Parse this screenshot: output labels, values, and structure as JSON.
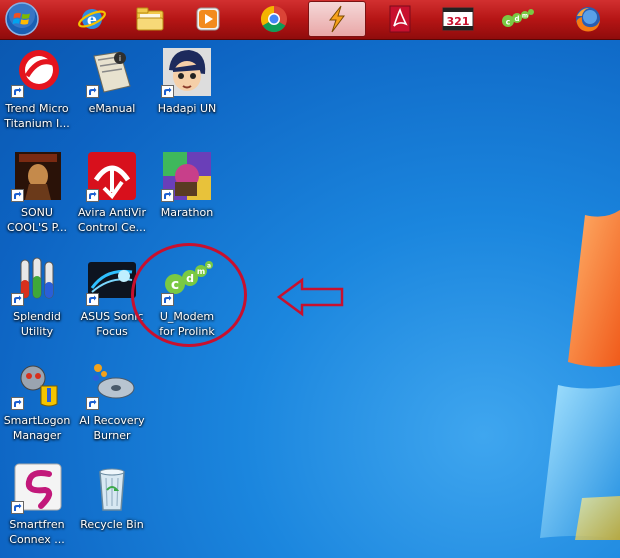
{
  "taskbar": {
    "items": [
      {
        "name": "start-button",
        "icon": "windows-orb-icon"
      },
      {
        "name": "internet-explorer",
        "icon": "internet-explorer-icon"
      },
      {
        "name": "windows-explorer",
        "icon": "folder-icon"
      },
      {
        "name": "media-player",
        "icon": "media-play-icon"
      },
      {
        "name": "chrome",
        "icon": "chrome-icon"
      },
      {
        "name": "winamp",
        "icon": "winamp-icon",
        "active": true
      },
      {
        "name": "acrobat-reader",
        "icon": "pdf-icon"
      },
      {
        "name": "media-player-classic",
        "icon": "media-player-321-icon",
        "text": "321"
      },
      {
        "name": "cdma-modem",
        "icon": "cdma-icon",
        "text": "cdma"
      },
      {
        "name": "firefox",
        "icon": "firefox-icon"
      }
    ]
  },
  "desktop": {
    "icons": [
      {
        "label1": "Trend Micro",
        "label2": "Titanium I..."
      },
      {
        "label1": "eManual",
        "label2": ""
      },
      {
        "label1": "Hadapi UN",
        "label2": ""
      },
      {
        "label1": "SONU",
        "label2": "COOL'S P..."
      },
      {
        "label1": "Avira AntiVir",
        "label2": "Control Ce..."
      },
      {
        "label1": "Marathon",
        "label2": ""
      },
      {
        "label1": "Splendid",
        "label2": "Utility"
      },
      {
        "label1": "ASUS Sonic",
        "label2": "Focus"
      },
      {
        "label1": "U_Modem",
        "label2": "for Prolink"
      },
      {
        "label1": "SmartLogon",
        "label2": "Manager"
      },
      {
        "label1": "AI Recovery",
        "label2": "Burner"
      },
      {
        "label1": "Smartfren",
        "label2": "Connex ..."
      },
      {
        "label1": "Recycle Bin",
        "label2": ""
      }
    ]
  },
  "annotation": {
    "circle_color": "#c8102e",
    "arrow_color": "#c8102e",
    "highlighted": "U_Modem for Prolink"
  }
}
